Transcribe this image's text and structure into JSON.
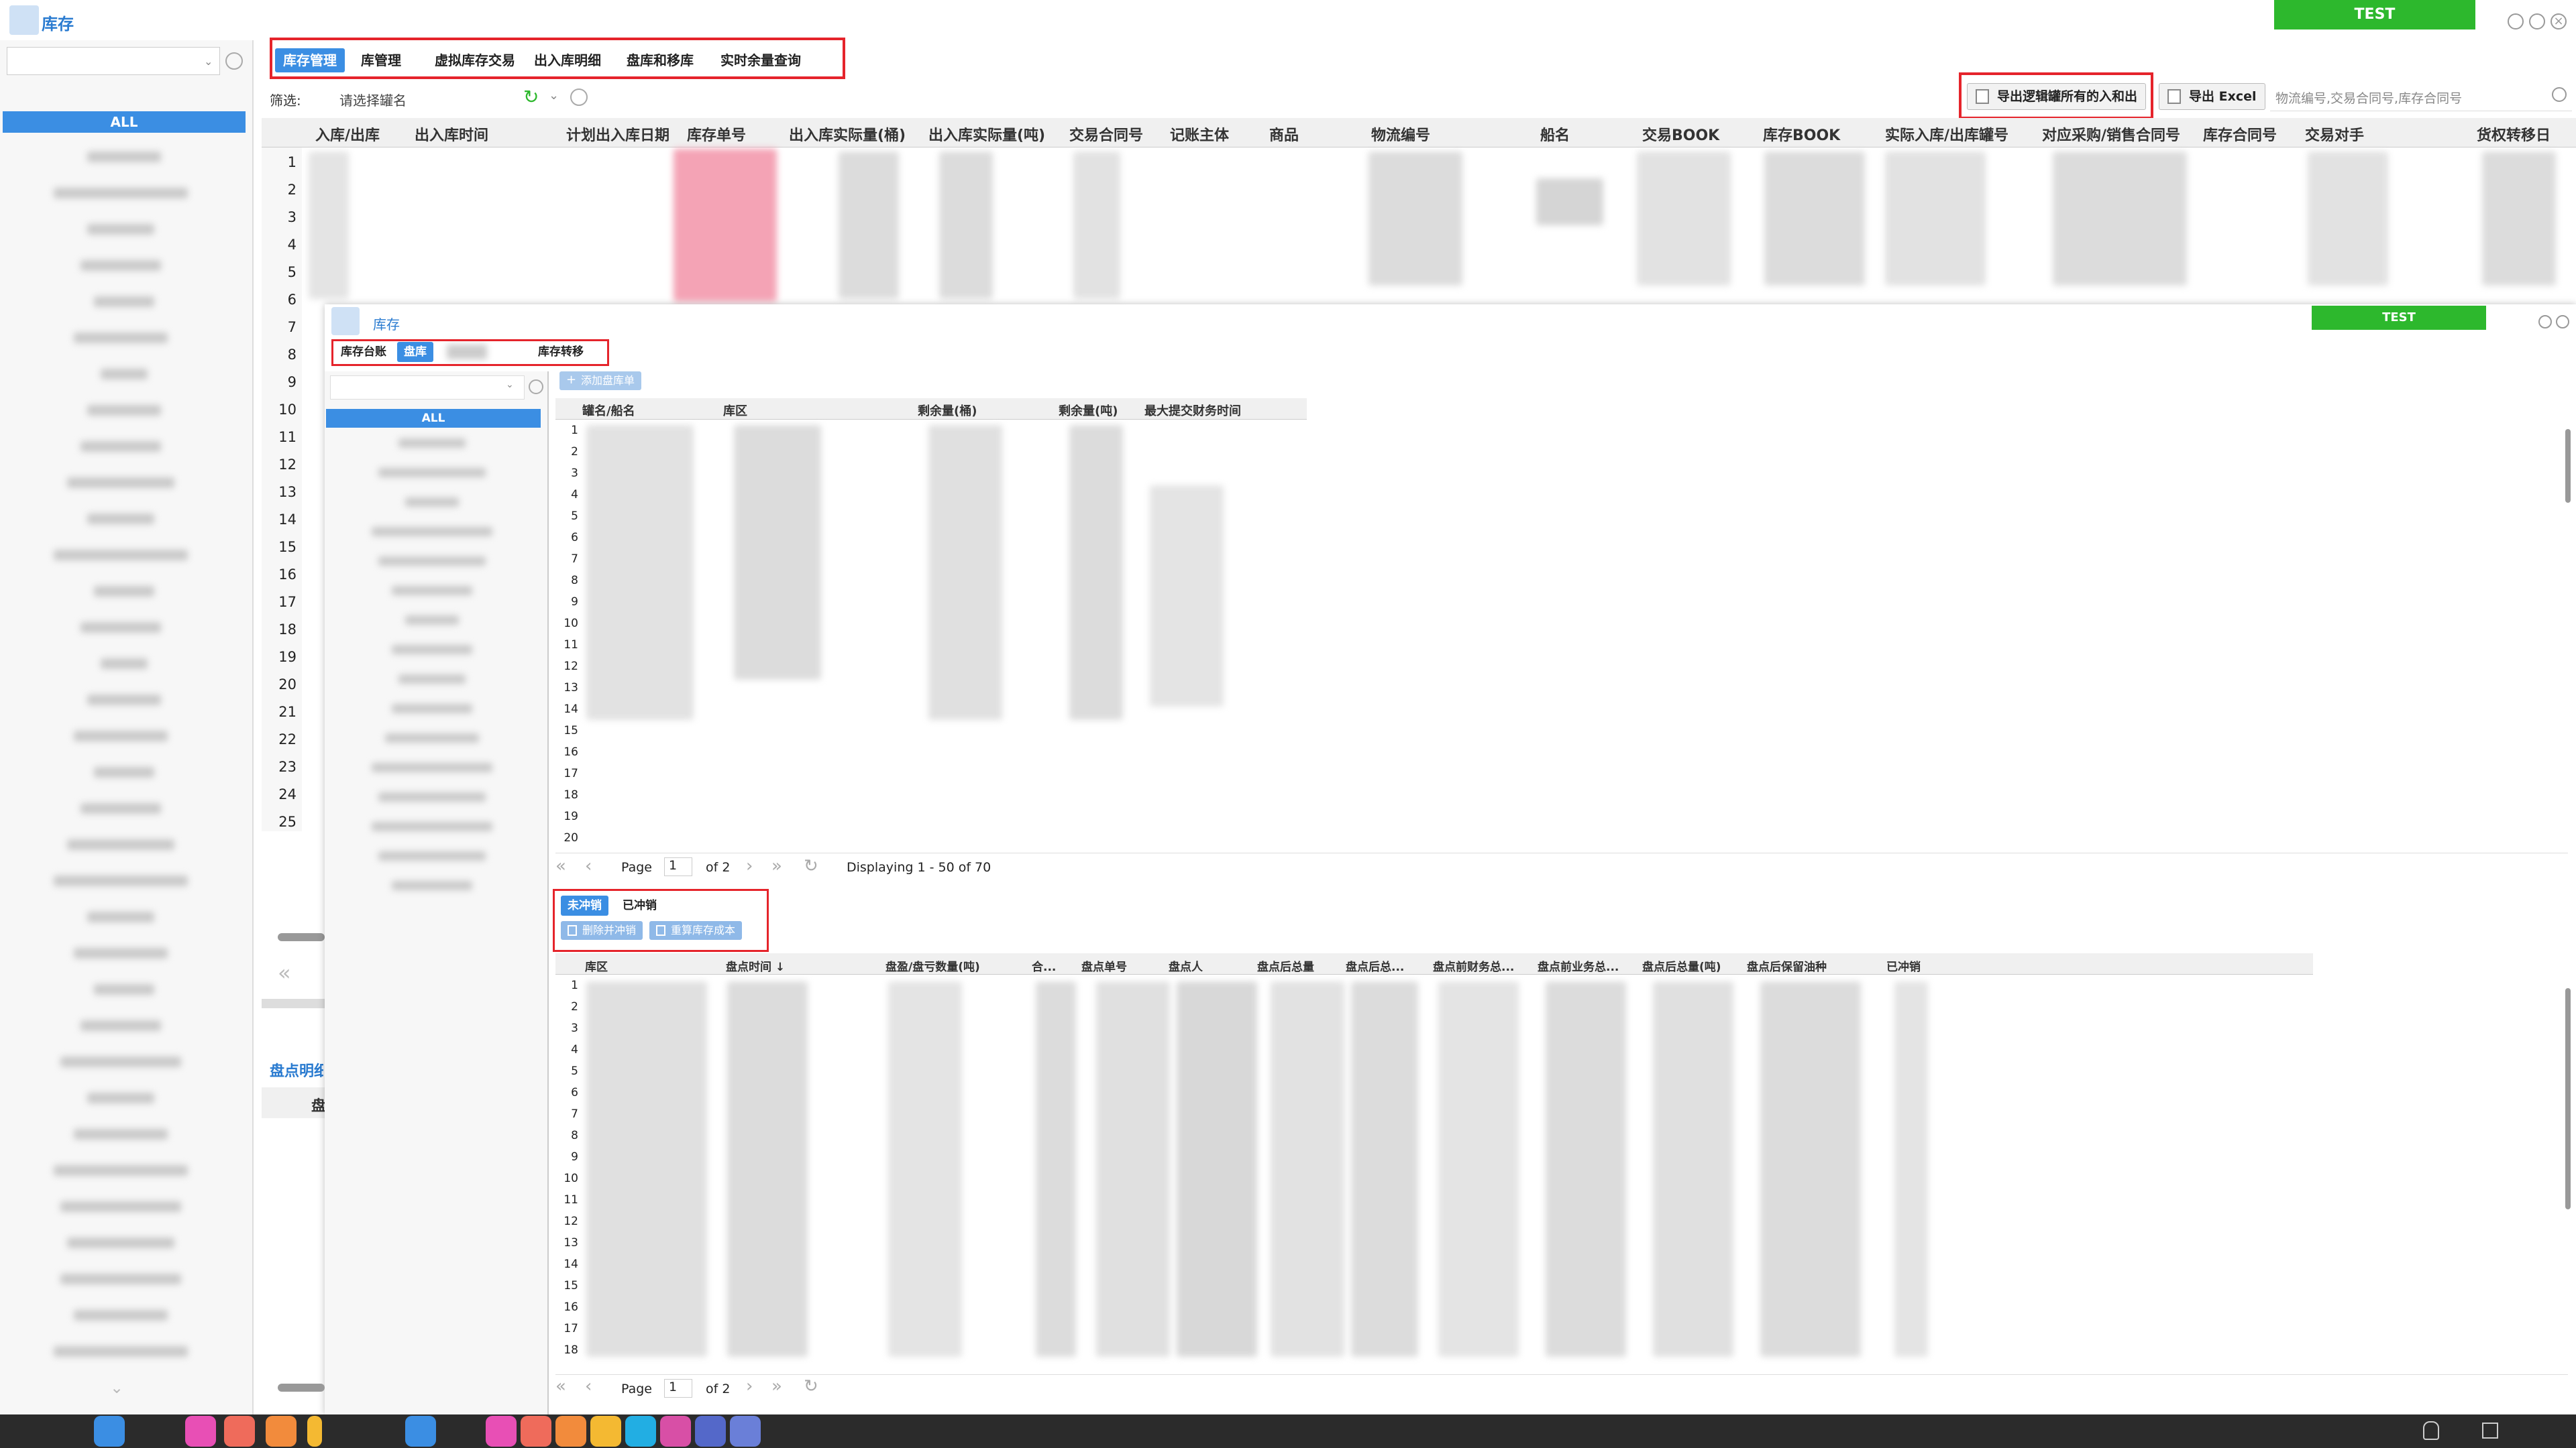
{
  "main_window": {
    "title": "库存",
    "test_label": "TEST",
    "sidebar_all": "ALL",
    "tabs": [
      {
        "label": "库存管理",
        "active": true
      },
      {
        "label": "库管理",
        "active": false
      },
      {
        "label": "虚拟库存交易",
        "active": false
      },
      {
        "label": "出入库明细",
        "active": false
      },
      {
        "label": "盘库和移库",
        "active": false
      },
      {
        "label": "实时余量查询",
        "active": false
      }
    ],
    "filter_label": "筛选:",
    "tank_select_placeholder": "请选择罐名",
    "export_logic_tank_button": "导出逻辑罐所有的入和出",
    "export_excel_button": "导出 Excel",
    "search_placeholder": "物流编号,交易合同号,库存合同号",
    "columns": [
      "入库/出库",
      "出入库时间",
      "计划出入库日期",
      "库存单号",
      "出入库实际量(桶)",
      "出入库实际量(吨)",
      "交易合同号",
      "记账主体",
      "商品",
      "物流编号",
      "船名",
      "交易BOOK",
      "库存BOOK",
      "实际入库/出库罐号",
      "对应采购/销售合同号",
      "库存合同号",
      "交易对手",
      "货权转移日"
    ],
    "row_numbers": [
      "1",
      "2",
      "3",
      "4",
      "5",
      "6",
      "7",
      "8",
      "9",
      "10",
      "11",
      "12",
      "13",
      "14",
      "15",
      "16",
      "17",
      "18",
      "19",
      "20",
      "21",
      "22",
      "23",
      "24",
      "25"
    ],
    "bottom_section_title": "盘点明细",
    "bottom_header_fragment": "盘"
  },
  "overlay_window": {
    "title": "库存",
    "test_label": "TEST",
    "sidebar_all": "ALL",
    "tabs": [
      {
        "label": "库存台账",
        "active": false
      },
      {
        "label": "盘库",
        "active": true
      },
      {
        "label": "库存转移",
        "active": false
      }
    ],
    "add_stocktake_button": "添加盘库单",
    "upper_columns": [
      "罐名/船名",
      "库区",
      "剩余量(桶)",
      "剩余量(吨)",
      "最大提交财务时间"
    ],
    "upper_row_numbers": [
      "1",
      "2",
      "3",
      "4",
      "5",
      "6",
      "7",
      "8",
      "9",
      "10",
      "11",
      "12",
      "13",
      "14",
      "15",
      "16",
      "17",
      "18",
      "19",
      "20"
    ],
    "upper_pager": {
      "page_label": "Page",
      "page_value": "1",
      "of_label": "of 2",
      "display": "Displaying 1 - 50 of 70"
    },
    "lower_tabs": [
      {
        "label": "未冲销",
        "active": true
      },
      {
        "label": "已冲销",
        "active": false
      }
    ],
    "delete_reverse_button": "删除并冲销",
    "recalc_cost_button": "重算库存成本",
    "lower_columns": [
      "库区",
      "盘点时间 ↓",
      "盘盈/盘亏数量(吨)",
      "合...",
      "盘点单号",
      "盘点人",
      "盘点后总量",
      "盘点后总...",
      "盘点前财务总...",
      "盘点前业务总...",
      "盘点后总量(吨)",
      "盘点后保留油种",
      "已冲销"
    ],
    "lower_row_numbers": [
      "1",
      "2",
      "3",
      "4",
      "5",
      "6",
      "7",
      "8",
      "9",
      "10",
      "11",
      "12",
      "13",
      "14",
      "15",
      "16",
      "17",
      "18"
    ],
    "lower_pager": {
      "page_label": "Page",
      "page_value": "1",
      "of_label": "of 2"
    }
  },
  "colors": {
    "accent_blue": "#3b8ee3",
    "test_green": "#2db82d",
    "highlight_red": "#e5242b",
    "pink_cells": "#f4a3b5"
  }
}
